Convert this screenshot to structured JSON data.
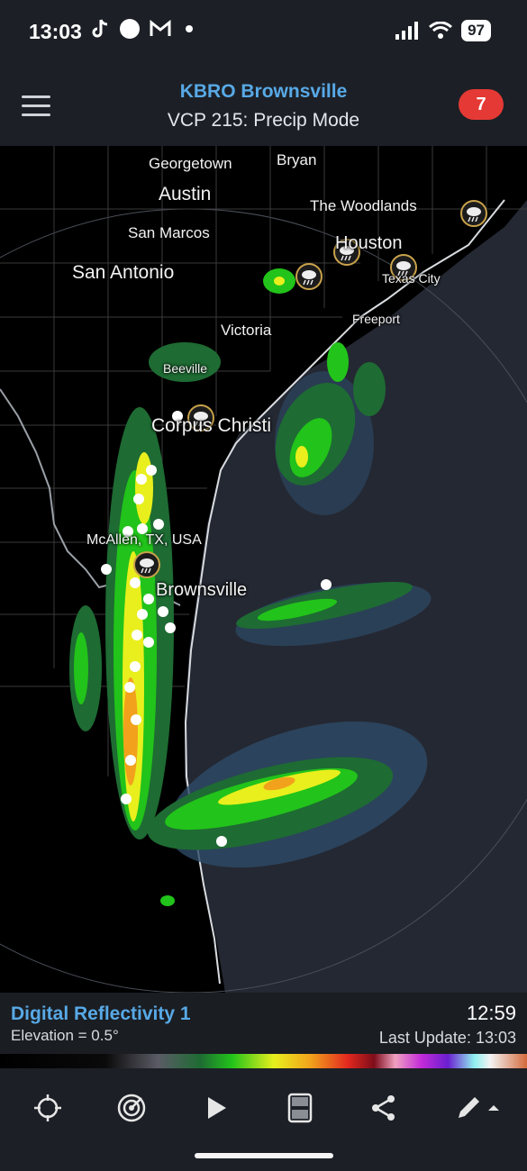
{
  "status_bar": {
    "time": "13:03",
    "left_icons": [
      "tiktok-icon",
      "circle-icon",
      "gmail-icon",
      "dot-icon"
    ],
    "right_icons": [
      "signal-icon",
      "wifi-icon"
    ],
    "battery": "97"
  },
  "header": {
    "station": "KBRO Brownsville",
    "mode": "VCP 215: Precip Mode",
    "alert_count": "7",
    "menu_icon": "hamburger-menu-icon"
  },
  "map": {
    "cities": {
      "georgetown": "Georgetown",
      "bryan": "Bryan",
      "austin": "Austin",
      "the_woodlands": "The Woodlands",
      "san_marcos": "San Marcos",
      "houston": "Houston",
      "san_antonio": "San Antonio",
      "texas_city": "Texas City",
      "freeport": "Freeport",
      "victoria": "Victoria",
      "beeville": "Beeville",
      "corpus_christi": "Corpus Christi",
      "mcallen": "McAllen, TX, USA",
      "brownsville": "Brownsville"
    },
    "weather_marker_icon": "rain-storm-icon",
    "report_marker_icon": "map-pin-icon"
  },
  "info": {
    "product": "Digital Reflectivity 1",
    "elevation": "Elevation = 0.5°",
    "scan_time": "12:59",
    "last_update": "Last Update: 13:03"
  },
  "nav": {
    "icons": [
      "locate-icon",
      "radar-icon",
      "play-icon",
      "layers-icon",
      "share-icon",
      "edit-icon"
    ]
  },
  "colors": {
    "accent": "#58a9e6",
    "alert": "#e53935",
    "background": "#1c2026"
  }
}
